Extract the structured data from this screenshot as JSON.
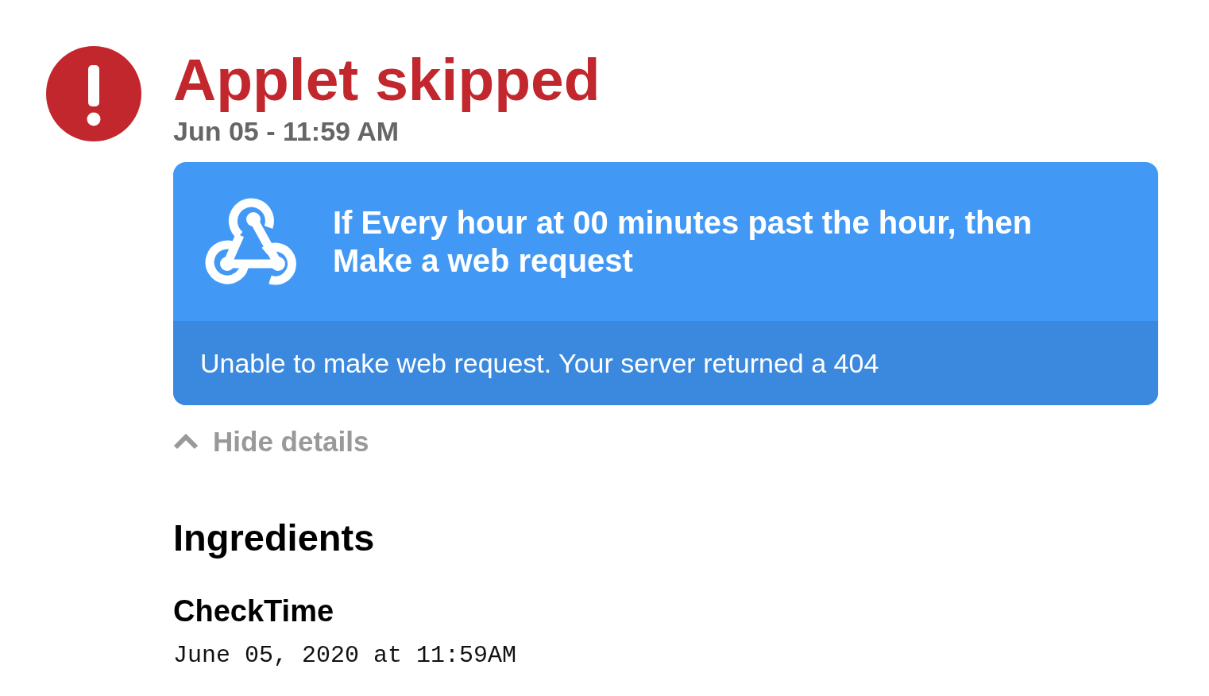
{
  "status": {
    "kind": "skipped",
    "title": "Applet skipped",
    "timestamp": "Jun 05 - 11:59 AM"
  },
  "applet_card": {
    "description_lines": [
      "If Every hour at 00 minutes past the hour, then",
      "Make a web request"
    ],
    "error_message": "Unable to make web request. Your server returned a 404"
  },
  "details_toggle": {
    "label": "Hide details",
    "expanded": true
  },
  "ingredients": {
    "title": "Ingredients",
    "items": [
      {
        "name": "CheckTime",
        "value": "June 05, 2020 at 11:59AM"
      }
    ]
  }
}
